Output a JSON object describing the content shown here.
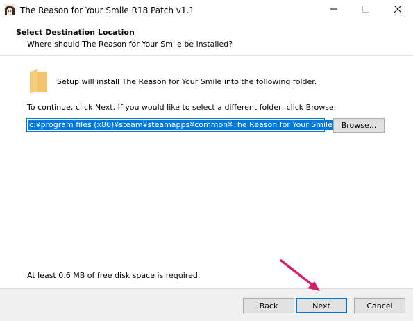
{
  "window": {
    "title": "The Reason for Your Smile R18 Patch v1.1",
    "app_icon": "anime-character-icon",
    "controls": {
      "minimize_icon": "minimize-icon",
      "maximize_icon": "maximize-icon",
      "close_icon": "close-icon"
    }
  },
  "header": {
    "title": "Select Destination Location",
    "subtitle": "Where should The Reason for Your Smile be installed?"
  },
  "body": {
    "folder_icon": "folder-icon",
    "install_text": "Setup will install The Reason for Your Smile into the following folder.",
    "continue_text": "To continue, click Next. If you would like to select a different folder, click Browse.",
    "path_value": "c:¥program files (x86)¥steam¥steamapps¥common¥The Reason for Your Smile",
    "browse_label": "Browse...",
    "disk_space_text": "At least 0.6 MB of free disk space is required."
  },
  "footer": {
    "back_label": "Back",
    "next_label": "Next",
    "cancel_label": "Cancel"
  },
  "annotation": {
    "arrow_color": "#d0226b",
    "arrow_icon": "pointer-arrow-icon"
  },
  "colors": {
    "accent": "#0078d7",
    "button_face": "#e1e1e1",
    "footer_bg": "#f0f0f0",
    "folder": "#f2c46b"
  }
}
